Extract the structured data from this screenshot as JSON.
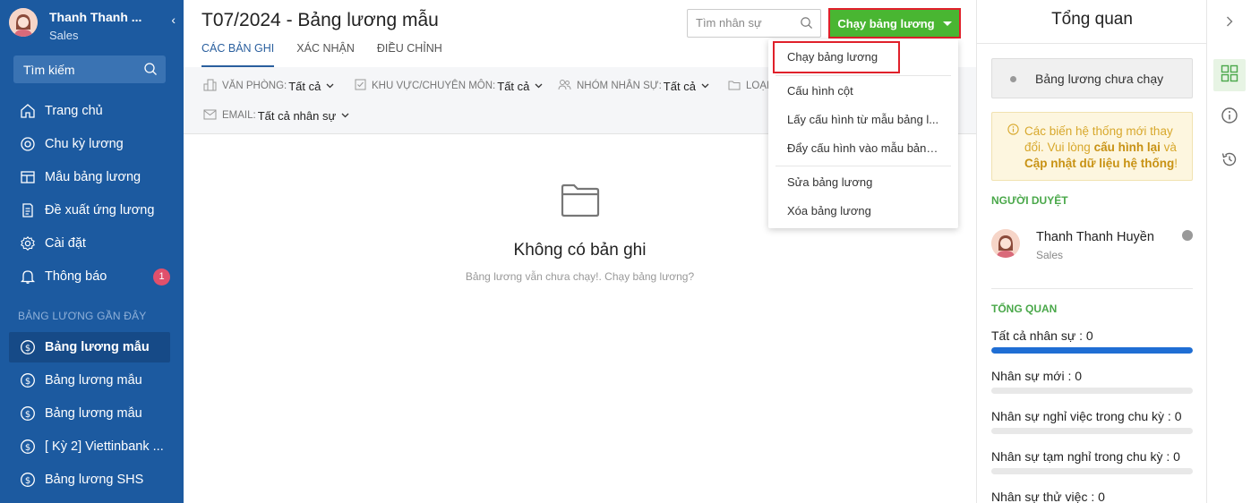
{
  "sidebar": {
    "user_name": "Thanh Thanh ...",
    "user_role": "Sales",
    "search_label": "Tìm kiếm",
    "nav": [
      {
        "label": "Trang chủ",
        "icon": "home-icon"
      },
      {
        "label": "Chu kỳ lương",
        "icon": "cycle-icon"
      },
      {
        "label": "Mẫu bảng lương",
        "icon": "template-icon"
      },
      {
        "label": "Đề xuất ứng lương",
        "icon": "document-icon"
      },
      {
        "label": "Cài đặt",
        "icon": "gear-icon"
      },
      {
        "label": "Thông báo",
        "icon": "bell-icon",
        "badge": "1"
      }
    ],
    "recent_title": "BẢNG LƯƠNG GẦN ĐÂY",
    "recent": [
      {
        "label": "Bảng lương mẫu",
        "active": true
      },
      {
        "label": "Bảng lương mẫu"
      },
      {
        "label": "Bảng lương mẫu"
      },
      {
        "label": "[ Kỳ 2] Viettinbank ..."
      },
      {
        "label": "Bảng lương SHS"
      }
    ]
  },
  "main": {
    "title": "T07/2024 - Bảng lương mẫu",
    "tabs": [
      "CÁC BẢN GHI",
      "XÁC NHẬN",
      "ĐIỀU CHỈNH"
    ],
    "search_placeholder": "Tìm nhân sự",
    "run_button": "Chạy bảng lương",
    "filters": [
      {
        "label": "VĂN PHÒNG:",
        "value": "Tất cả"
      },
      {
        "label": "KHU VỰC/CHUYÊN MÔN:",
        "value": "Tất cả"
      },
      {
        "label": "NHÓM NHÂN SỰ:",
        "value": "Tất cả"
      },
      {
        "label": "LOẠI",
        "value": ""
      },
      {
        "label": "EMAIL:",
        "value": "Tất cả nhân sự"
      }
    ],
    "empty_title": "Không có bản ghi",
    "empty_subtitle": "Bảng lương vẫn chưa chạy!. Chạy bảng lương?"
  },
  "dropdown": {
    "items": [
      "Chạy bảng lương",
      "Cấu hình cột",
      "Lấy cấu hình từ mẫu bảng l...",
      "Đẩy cấu hình vào mẫu bảng...",
      "Sửa bảng lương",
      "Xóa bảng lương"
    ]
  },
  "overview": {
    "title": "Tổng quan",
    "status": "Bảng lương chưa chạy",
    "warning": {
      "part1": "Các biến hệ thống mới thay đổi. Vui lòng ",
      "link1": "cấu hình lại",
      "part2": " và ",
      "link2": "Cập nhật dữ liệu hệ thống",
      "part3": "!"
    },
    "approver_label": "NGƯỜI DUYỆT",
    "approver_name": "Thanh Thanh Huyền",
    "approver_role": "Sales",
    "summary_label": "TỔNG QUAN",
    "stats": [
      {
        "label": "Tất cả nhân sự : 0",
        "fill": 1.0
      },
      {
        "label": "Nhân sự mới : 0",
        "fill": 0
      },
      {
        "label": "Nhân sự nghỉ việc trong chu kỳ : 0",
        "fill": 0
      },
      {
        "label": "Nhân sự tạm nghỉ trong chu kỳ : 0",
        "fill": 0
      },
      {
        "label": "Nhân sự thử việc : 0",
        "fill": 0
      }
    ]
  },
  "colors": {
    "sidebar": "#1c5aa0",
    "run_button": "#49b632",
    "highlight": "#e0202a",
    "accent_green": "#4aa84a",
    "bar_fill": "#1f6ed4"
  }
}
